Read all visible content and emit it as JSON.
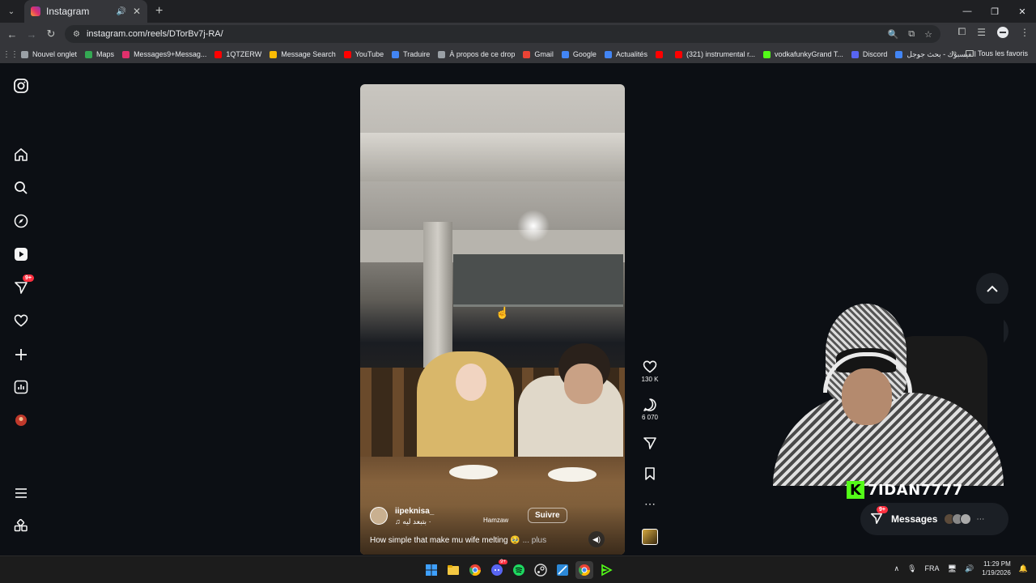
{
  "browser": {
    "tab_title": "Instagram",
    "url": "instagram.com/reels/DTorBv7j-RA/",
    "bookmarks": [
      {
        "label": "Nouvel onglet",
        "color": "#9aa0a6"
      },
      {
        "label": "Maps",
        "color": "#34a853"
      },
      {
        "label": "Messages9+Messag...",
        "color": "#e1306c"
      },
      {
        "label": "1QTZERW",
        "color": "#ff0000"
      },
      {
        "label": "Message Search",
        "color": "#fbbc04"
      },
      {
        "label": "YouTube",
        "color": "#ff0000"
      },
      {
        "label": "Traduire",
        "color": "#4285f4"
      },
      {
        "label": "À propos de ce drop",
        "color": "#9aa0a6"
      },
      {
        "label": "Gmail",
        "color": "#ea4335"
      },
      {
        "label": "Google",
        "color": "#4285f4"
      },
      {
        "label": "Actualités",
        "color": "#4285f4"
      },
      {
        "label": "",
        "color": "#ff0000"
      },
      {
        "label": "(321) instrumental r...",
        "color": "#ff0000"
      },
      {
        "label": "vodkafunkyGrand T...",
        "color": "#53fc18"
      },
      {
        "label": "Discord",
        "color": "#5865f2"
      },
      {
        "label": "الفيسبوك - بحث جوجل",
        "color": "#4285f4"
      }
    ],
    "all_bookmarks": "Tous les favoris"
  },
  "reel": {
    "username": "iipeknisa_",
    "audio": "بتبعد ليه ·",
    "tag": "Hamzaw",
    "follow_label": "Suivre",
    "caption": "How simple that make mu wife melting 🥹",
    "caption_more": "... plus",
    "likes": "130 K",
    "comments": "6 070"
  },
  "sidebar": {
    "notifications_badge": "9+"
  },
  "stream": {
    "name": "7IDAN7777"
  },
  "messages": {
    "label": "Messages",
    "badge": "9+"
  },
  "taskbar": {
    "lang": "FRA",
    "time": "11:29 PM",
    "date": "1/19/2026",
    "discord_badge": "9+"
  },
  "colors": {
    "instagram_badge": "#ff3040",
    "kick_green": "#53fc18"
  }
}
